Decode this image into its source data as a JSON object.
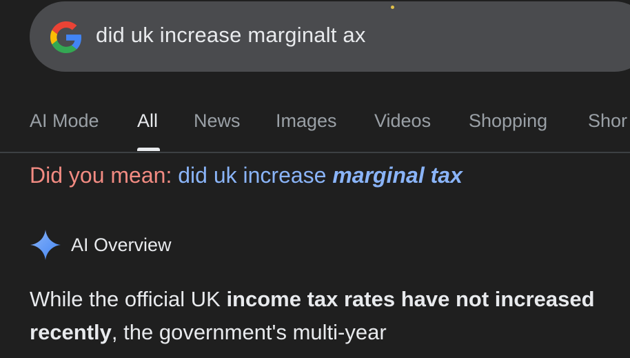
{
  "search": {
    "query": "did uk increase marginalt ax",
    "logo_icon": "google-g-icon"
  },
  "tabs": [
    {
      "label": "AI Mode",
      "active": false
    },
    {
      "label": "All",
      "active": true
    },
    {
      "label": "News",
      "active": false
    },
    {
      "label": "Images",
      "active": false
    },
    {
      "label": "Videos",
      "active": false
    },
    {
      "label": "Shopping",
      "active": false
    },
    {
      "label": "Shor",
      "active": false
    }
  ],
  "did_you_mean": {
    "label": "Did you mean:",
    "plain": "did uk increase",
    "emphasis": "marginal tax"
  },
  "ai_overview": {
    "icon": "sparkle-icon",
    "title": "AI Overview",
    "text_1": "While the official UK ",
    "bold_1": "income tax rates have not increased recently",
    "text_2": ", the government's multi-year"
  },
  "colors": {
    "background": "#1f1f1f",
    "search_bar": "#4a4b4e",
    "suggestion_label": "#f28b82",
    "link": "#8ab4f8",
    "muted_tab": "#9aa0a6",
    "text": "#e8eaed"
  }
}
